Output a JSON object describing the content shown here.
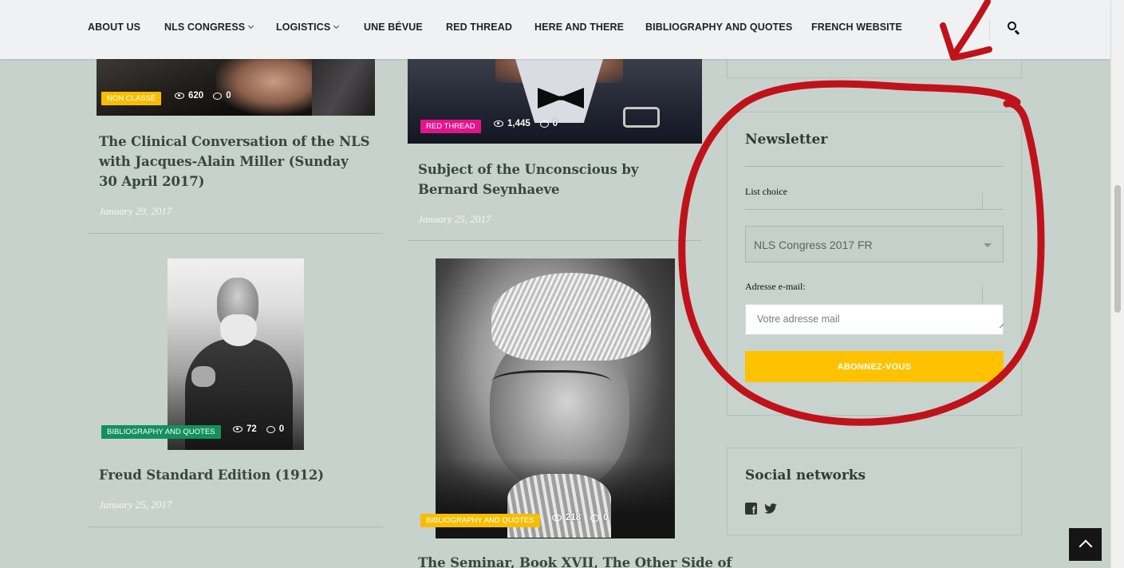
{
  "nav": {
    "items": [
      {
        "label": "ABOUT US",
        "dropdown": false
      },
      {
        "label": "NLS CONGRESS",
        "dropdown": true
      },
      {
        "label": "LOGISTICS",
        "dropdown": true
      },
      {
        "label": "UNE BÉVUE",
        "dropdown": false
      },
      {
        "label": "RED THREAD",
        "dropdown": false
      },
      {
        "label": "HERE AND THERE",
        "dropdown": false
      },
      {
        "label": "BIBLIOGRAPHY AND QUOTES",
        "dropdown": false
      },
      {
        "label": "FRENCH WEBSITE",
        "dropdown": false
      }
    ],
    "search_icon": "search-icon"
  },
  "posts": [
    {
      "category": "NON CLASSÉ",
      "category_color": "#f7bd00",
      "views": "620",
      "comments": "0",
      "title": "The Clinical Conversation of the NLS with Jacques-Alain Miller (Sunday 30 April 2017)",
      "date": "January 29, 2017"
    },
    {
      "category": "RED THREAD",
      "category_color": "#e2148c",
      "views": "1,445",
      "comments": "0",
      "title": "Subject of the Unconscious by Bernard Seynhaeve",
      "date": "January 25, 2017"
    },
    {
      "category": "BIBLIOGRAPHY AND QUOTES",
      "category_color": "#139060",
      "views": "72",
      "comments": "0",
      "title": "Freud Standard Edition (1912)",
      "date": "January 25, 2017"
    },
    {
      "category": "BIBLIOGRAPHY AND QUOTES",
      "category_color": "#f7bd00",
      "views": "218",
      "comments": "0",
      "title": "The Seminar, Book XVII, The Other Side of",
      "date": ""
    }
  ],
  "newsletter": {
    "title": "Newsletter",
    "list_label": "List choice",
    "list_selected": "NLS Congress 2017 FR",
    "email_label": "Adresse e-mail:",
    "email_placeholder": "Votre adresse mail",
    "email_value": "",
    "submit_label": "ABONNEZ-VOUS",
    "submit_color": "#ffc200"
  },
  "social": {
    "title": "Social networks",
    "icons": [
      "facebook-icon",
      "twitter-icon"
    ]
  },
  "annotation_color": "#c0121b",
  "back_to_top_icon": "chevron-up-icon"
}
